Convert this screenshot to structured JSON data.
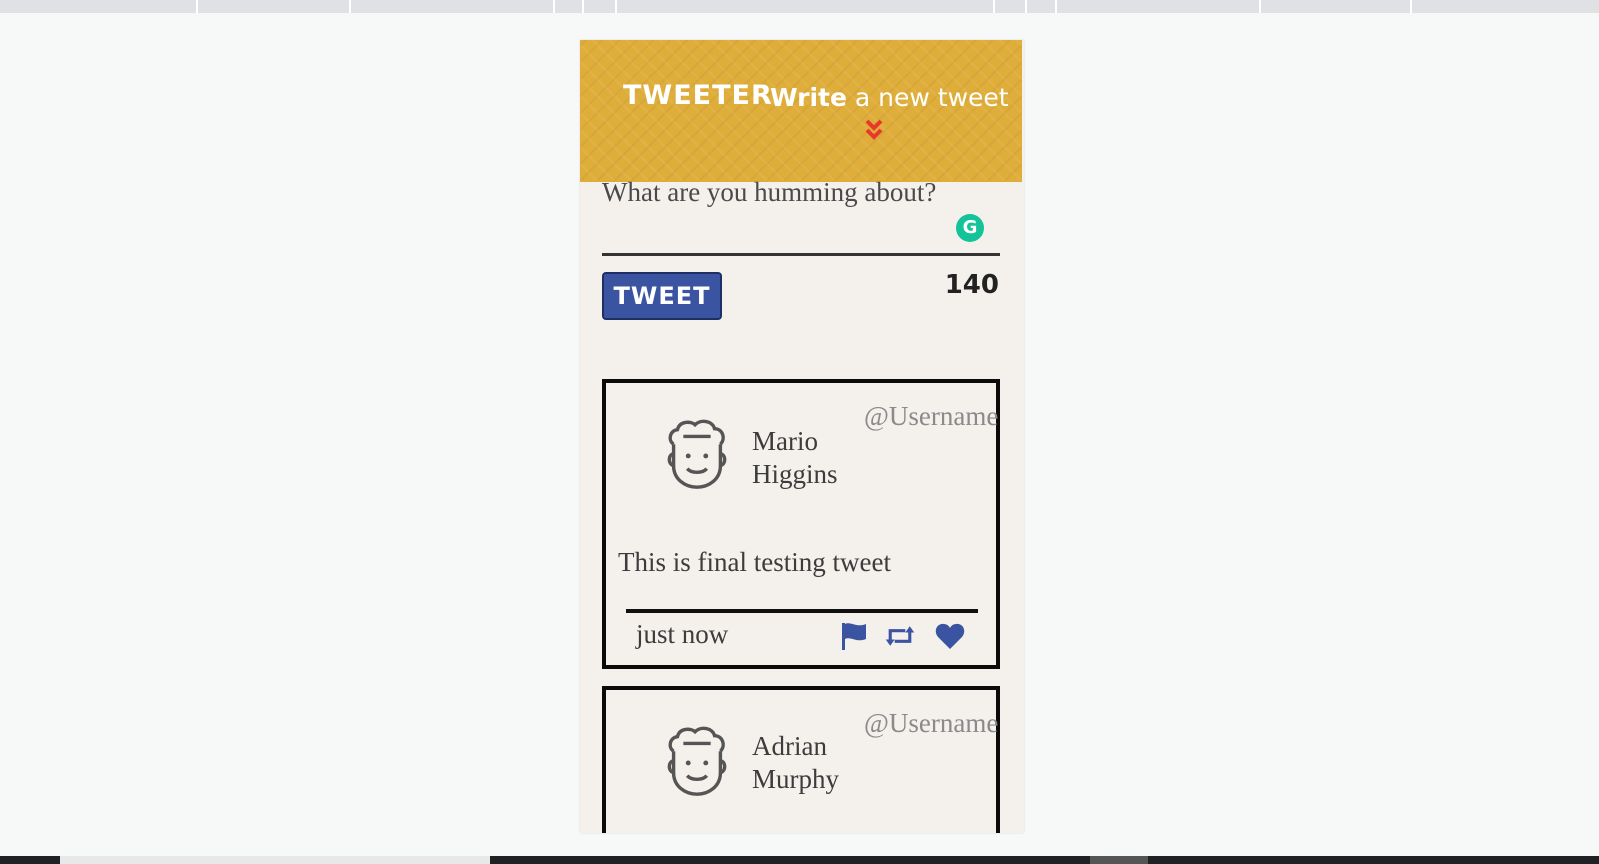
{
  "app": {
    "brand": "TWEETER",
    "compose_title_bold": "Write",
    "compose_title_rest": "a new tweet",
    "accent_color": "#dfae3a",
    "button_color": "#3b54a1"
  },
  "composer": {
    "placeholder": "What are you humming about?",
    "tweet_button_label": "TWEET",
    "char_counter": "140"
  },
  "tweets": [
    {
      "first_name": "Mario",
      "last_name": "Higgins",
      "handle": "@Username",
      "content": "This is final testing tweet",
      "timestamp": "just now",
      "icons": [
        "flag-icon",
        "retweet-icon",
        "heart-icon"
      ]
    },
    {
      "first_name": "Adrian",
      "last_name": "Murphy",
      "handle": "@Username"
    }
  ]
}
